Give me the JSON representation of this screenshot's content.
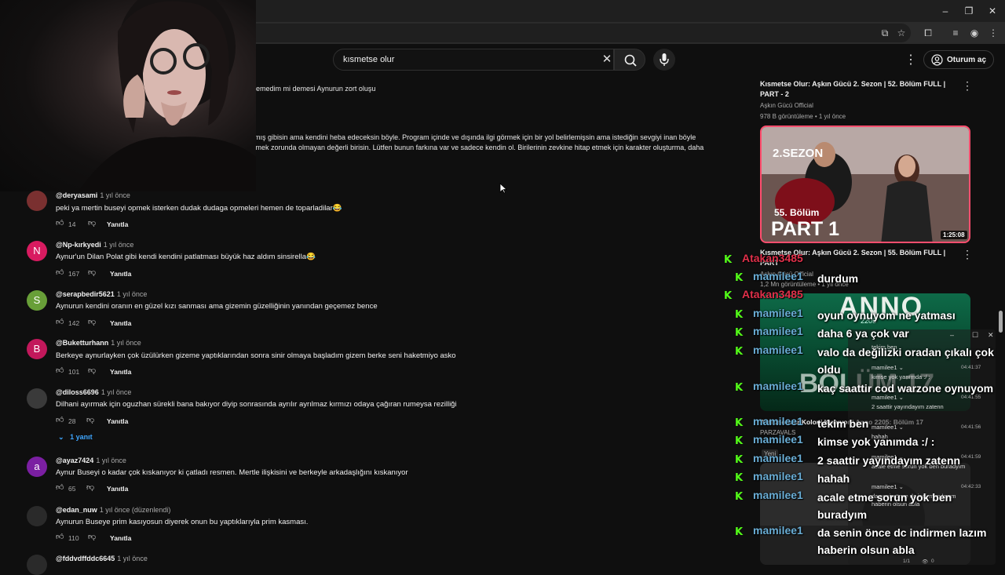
{
  "search": {
    "query": "kısmetse olur"
  },
  "header": {
    "signin_label": "Oturum aç"
  },
  "partial_comment": {
    "line1": "emedim mi demesi Aynurun zort oluşu",
    "line2": "ş, kırılmış gibisin ama kendini heba edeceksin böyle. Program içinde ve dışında ilgi görmek için bir yol belirlemişsin ama istediğin sevgiyi inan böyle",
    "line3": "yükselmek zorunda olmayan değerli birisin. Lütfen bunun farkına var ve sadece kendin ol. Birilerinin zevkine hitap etmek için karakter oluşturma, daha"
  },
  "comments": [
    {
      "initial": "",
      "avatar_color": "#7a3030",
      "author": "@deryasami",
      "time": "1 yıl önce",
      "text": "peki ya mertin buseyi opmek isterken dudak dudaga opmeleri hemen de toparladilar😂",
      "likes": "14",
      "reply": "Yanıtla"
    },
    {
      "initial": "N",
      "avatar_color": "#d81b60",
      "author": "@Np-kırkyedi",
      "time": "1 yıl önce",
      "text": "Aynur'un Dilan Polat gibi kendi kendini patlatması büyük haz aldım sinsirella😂",
      "likes": "167",
      "reply": "Yanıtla"
    },
    {
      "initial": "S",
      "avatar_color": "#689f38",
      "author": "@serapbedir5621",
      "time": "1 yıl önce",
      "text": "Aynurun kendini oranın en güzel kızı sanması ama gizemin güzelliğinin yanından geçemez bence",
      "likes": "142",
      "reply": "Yanıtla"
    },
    {
      "initial": "B",
      "avatar_color": "#c2185b",
      "author": "@Buketturhann",
      "time": "1 yıl önce",
      "text": "Berkeye aynurlayken çok üzülürken gizeme yaptıklarından sonra sinir olmaya başladım gizem berke seni haketmiyo asko",
      "likes": "101",
      "reply": "Yanıtla"
    },
    {
      "initial": "",
      "avatar_color": "#3a3a3a",
      "author": "@diloss6696",
      "time": "1 yıl önce",
      "text": "Dilhani ayırmak için oguzhan sürekli bana bakıyor diyip sonrasında ayrılır ayrılmaz kırmızı odaya çağıran rumeysa rezilliği",
      "likes": "28",
      "reply": "Yanıtla"
    },
    {
      "initial": "a",
      "avatar_color": "#7b1fa2",
      "author": "@ayaz7424",
      "time": "1 yıl önce",
      "text": "Aynur Buseyi o kadar çok kıskanıyor ki çatladı resmen. Mertle ilişkisini ve berkeyle arkadaşlığını kıskanıyor",
      "likes": "65",
      "reply": "Yanıtla"
    },
    {
      "initial": "",
      "avatar_color": "#2a2a2a",
      "author": "@edan_nuw",
      "time": "1 yıl önce (düzenlendi)",
      "text": "Aynurun Buseye prim kasıyosun diyerek onun bu yaptıklarıyla prim kasması.",
      "likes": "110",
      "reply": "Yanıtla"
    },
    {
      "initial": "",
      "avatar_color": "#2a2a2a",
      "author": "@fddvdffddc6645",
      "time": "1 yıl önce",
      "text": "",
      "likes": "",
      "reply": ""
    }
  ],
  "replies_toggle": "1 yanıt",
  "sidebar": {
    "videos": [
      {
        "title": "Kısmetse Olur: Aşkın Gücü 2. Sezon | 52. Bölüm FULL | PART - 2",
        "channel": "Aşkın Gücü Official",
        "meta": "978 B görüntüleme • 1 yıl önce"
      },
      {
        "title": "Kısmetse Olur: Aşkın Gücü 2. Sezon | 55. Bölüm FULL | PART",
        "channel": "Aşkın Gücü Official",
        "meta": "1,2 Mn görüntüleme • 1 yıl önce",
        "thumb_season": "2.SEZON",
        "thumb_ep": "55. Bölüm",
        "thumb_part": "PART 1",
        "duration": "1:25:08"
      },
      {
        "title": "Astronomlar Koloni Kuruyor | Anno 2205: Bölüm 17",
        "channel": "PARZAVALS",
        "meta": "Yeni",
        "thumb_game": "ANNO",
        "thumb_year": "2205",
        "thumb_ep": "BÖLÜM 17"
      }
    ]
  },
  "chat": [
    {
      "user": "Atakan3485",
      "msg": "",
      "color": "#e0304a"
    },
    {
      "user": "mamilee1",
      "msg": "durdum",
      "color": "#6aaed6"
    },
    {
      "user": "Atakan3485",
      "msg": "",
      "color": "#e0304a"
    },
    {
      "user": "mamilee1",
      "msg": "oyun oynuyom ne yatması",
      "color": "#6aaed6"
    },
    {
      "user": "mamilee1",
      "msg": "daha 6 ya çok var",
      "color": "#6aaed6"
    },
    {
      "user": "mamilee1",
      "msg": "valo da değilizki oradan çıkalı çok oldu",
      "color": "#6aaed6"
    },
    {
      "user": "mamilee1",
      "msg": "kaç saattir cod warzone oynuyom",
      "color": "#6aaed6"
    },
    {
      "user": "mamilee1",
      "msg": "tekim ben",
      "color": "#6aaed6"
    },
    {
      "user": "mamilee1",
      "msg": "kimse yok yanımda :/ :",
      "color": "#6aaed6"
    },
    {
      "user": "mamilee1",
      "msg": "2 saattir yayındayım zatenn",
      "color": "#6aaed6"
    },
    {
      "user": "mamilee1",
      "msg": "hahah",
      "color": "#6aaed6"
    },
    {
      "user": "mamilee1",
      "msg": "acale etme sorun yok ben buradyım",
      "color": "#6aaed6"
    },
    {
      "user": "mamilee1",
      "msg": "da senin önce dc indirmen lazım haberin olsun abla",
      "color": "#6aaed6"
    }
  ],
  "popup": {
    "lines": [
      "tekim ben",
      "mamilee1 ⌄",
      "kimse yok yanımda :/ :",
      "mamilee1 ⌄",
      "2 saattir yayındayım zatenn",
      "mamilee1 ⌄",
      "hahah",
      "mamilee1 ⌄",
      "acale etme sorun yok ben buradyım",
      "mamilee1 ⌄",
      "da senin önce dc indirmen lazım",
      "haberin olsun abla"
    ],
    "times": [
      "04:41:37",
      "04:41:55",
      "04:41:56",
      "04:41:59",
      "04:42:33"
    ],
    "counter": "1/1",
    "views": "0"
  }
}
